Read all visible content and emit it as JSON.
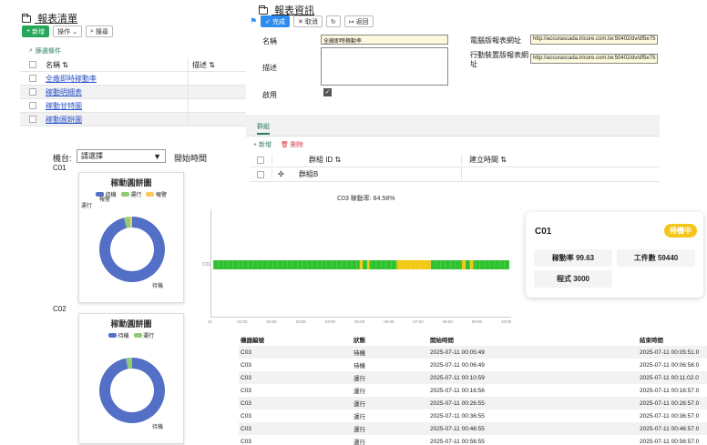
{
  "list_panel": {
    "title": "報表清單",
    "add_label": "新增",
    "ops_label": "操作",
    "search_label": "搜尋",
    "filter_label": "篩選條件",
    "col_name": "名稱",
    "col_desc": "描述",
    "rows": [
      "全廠即時稼動率",
      "稼動明細表",
      "稼動甘特圖",
      "稼動圓餅圖"
    ]
  },
  "info_panel": {
    "title": "報表資訊",
    "done_label": "完成",
    "cancel_label": "取消",
    "back_label": "返回",
    "name_label": "名稱",
    "name_value": "全廠即時稼動率",
    "desc_label": "描述",
    "enabled_label": "啟用",
    "pc_url_label": "電腦版報表網址",
    "pc_url_value": "http://accurascada.tricore.com.tw:50402/dv/df5e75",
    "mobile_url_label": "行動裝置版報表網址",
    "mobile_url_value": "http://accurascada.tricore.com.tw:50402/dv/df5e75",
    "tab_group": "群組",
    "group_add": "新增",
    "group_delete": "刪除",
    "group_col_id": "群組 ID",
    "group_col_time": "建立時間",
    "group_rows": [
      "群組B"
    ]
  },
  "filter": {
    "machine_label": "機台:",
    "machine_value": "請選擇",
    "start_label": "開始時間"
  },
  "pie_cards": [
    {
      "machine": "C01",
      "title": "稼動圓餅圖",
      "legend": [
        "待機",
        "運行",
        "報警"
      ],
      "slice_labels": [
        "報警",
        "運行",
        "待機"
      ]
    },
    {
      "machine": "C02",
      "title": "稼動圓餅圖",
      "legend": [
        "待機",
        "運行"
      ],
      "slice_labels": [
        "待機"
      ]
    }
  ],
  "colors": {
    "standby": "#5470c6",
    "running": "#91cc75",
    "alarm": "#fac858",
    "gantt_run": "#2fc12f",
    "gantt_idle": "#f2c811"
  },
  "gantt": {
    "title": "C03 稼動率: 84.58%",
    "row_label": "C01",
    "ticks": [
      "11",
      "01:00",
      "02:00",
      "03:00",
      "04:00",
      "05:00",
      "06:00",
      "07:00",
      "08:00",
      "09:00",
      "10:00"
    ]
  },
  "chart_data": [
    {
      "type": "pie",
      "machine": "C01",
      "series": [
        {
          "name": "待機",
          "value": 96
        },
        {
          "name": "運行",
          "value": 3
        },
        {
          "name": "報警",
          "value": 1
        }
      ]
    },
    {
      "type": "pie",
      "machine": "C02",
      "series": [
        {
          "name": "待機",
          "value": 97
        },
        {
          "name": "運行",
          "value": 3
        }
      ]
    },
    {
      "type": "bar",
      "machine": "C03",
      "orientation": "horizontal-timeline",
      "segments": [
        {
          "state": "run",
          "from": 0.0,
          "to": 0.495
        },
        {
          "state": "idle",
          "from": 0.495,
          "to": 0.505
        },
        {
          "state": "run",
          "from": 0.505,
          "to": 0.52
        },
        {
          "state": "idle",
          "from": 0.52,
          "to": 0.528
        },
        {
          "state": "run",
          "from": 0.528,
          "to": 0.62
        },
        {
          "state": "idle",
          "from": 0.62,
          "to": 0.735
        },
        {
          "state": "run",
          "from": 0.735,
          "to": 0.84
        },
        {
          "state": "idle",
          "from": 0.84,
          "to": 0.852
        },
        {
          "state": "run",
          "from": 0.852,
          "to": 0.868
        },
        {
          "state": "idle",
          "from": 0.868,
          "to": 0.878
        },
        {
          "state": "run",
          "from": 0.878,
          "to": 1.0
        }
      ]
    }
  ],
  "status_card": {
    "machine": "C01",
    "badge": "待機中",
    "metrics": [
      "稼動率 99.63",
      "工件數 59440",
      "程式 3000"
    ]
  },
  "records": {
    "headers": [
      "機器編號",
      "狀態",
      "開始時間",
      "結束時間"
    ],
    "rows": [
      [
        "C03",
        "待機",
        "2025-07-11 00:05:49",
        "2025-07-11 00:05:51.0"
      ],
      [
        "C03",
        "待機",
        "2025-07-11 00:06:49",
        "2025-07-11 00:06:58.0"
      ],
      [
        "C03",
        "運行",
        "2025-07-11 00:10:59",
        "2025-07-11 00:11:02.0"
      ],
      [
        "C03",
        "運行",
        "2025-07-11 00:16:56",
        "2025-07-11 00:16:57.0"
      ],
      [
        "C03",
        "運行",
        "2025-07-11 00:26:55",
        "2025-07-11 00:26:57.0"
      ],
      [
        "C03",
        "運行",
        "2025-07-11 00:36:55",
        "2025-07-11 00:36:57.0"
      ],
      [
        "C03",
        "運行",
        "2025-07-11 00:46:55",
        "2025-07-11 00:46:57.0"
      ],
      [
        "C03",
        "運行",
        "2025-07-11 00:56:55",
        "2025-07-11 00:56:57.0"
      ]
    ]
  }
}
